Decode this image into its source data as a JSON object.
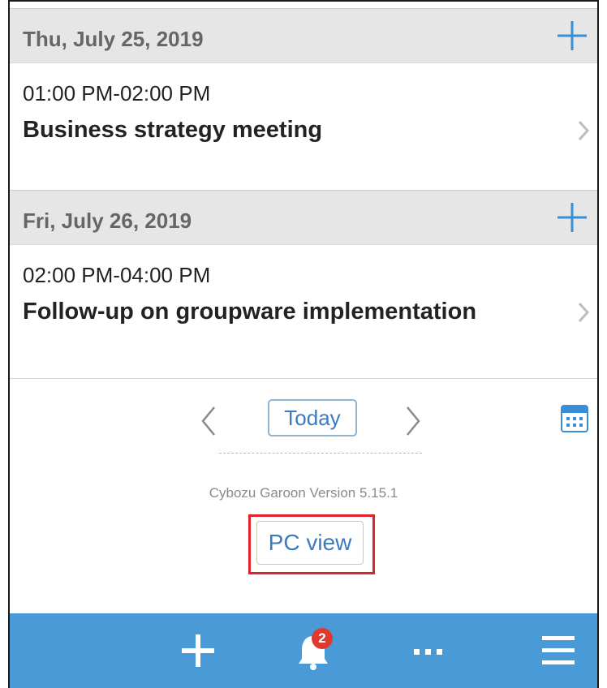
{
  "days": [
    {
      "date": "Thu, July 25, 2019",
      "add_icon": "plus-icon",
      "event": {
        "time": "01:00 PM-02:00 PM",
        "title": "Business strategy meeting"
      }
    },
    {
      "date": "Fri, July 26, 2019",
      "add_icon": "plus-icon",
      "event": {
        "time": "02:00 PM-04:00 PM",
        "title": "Follow-up on groupware implementation"
      }
    }
  ],
  "nav": {
    "prev_icon": "chevron-left-icon",
    "today_label": "Today",
    "next_icon": "chevron-right-icon",
    "calendar_icon": "calendar-icon"
  },
  "footer": {
    "version": "Cybozu Garoon Version 5.15.1",
    "pc_view_label": "PC view",
    "highlight_color": "#e0232b"
  },
  "bottom_bar": {
    "color": "#4b9ad8",
    "items": [
      "plus-icon",
      "bell-icon",
      "more-icon",
      "menu-icon"
    ],
    "notification_count": "2"
  },
  "colors": {
    "accent": "#3a7bbf",
    "header_bg": "#e6e6e6"
  }
}
